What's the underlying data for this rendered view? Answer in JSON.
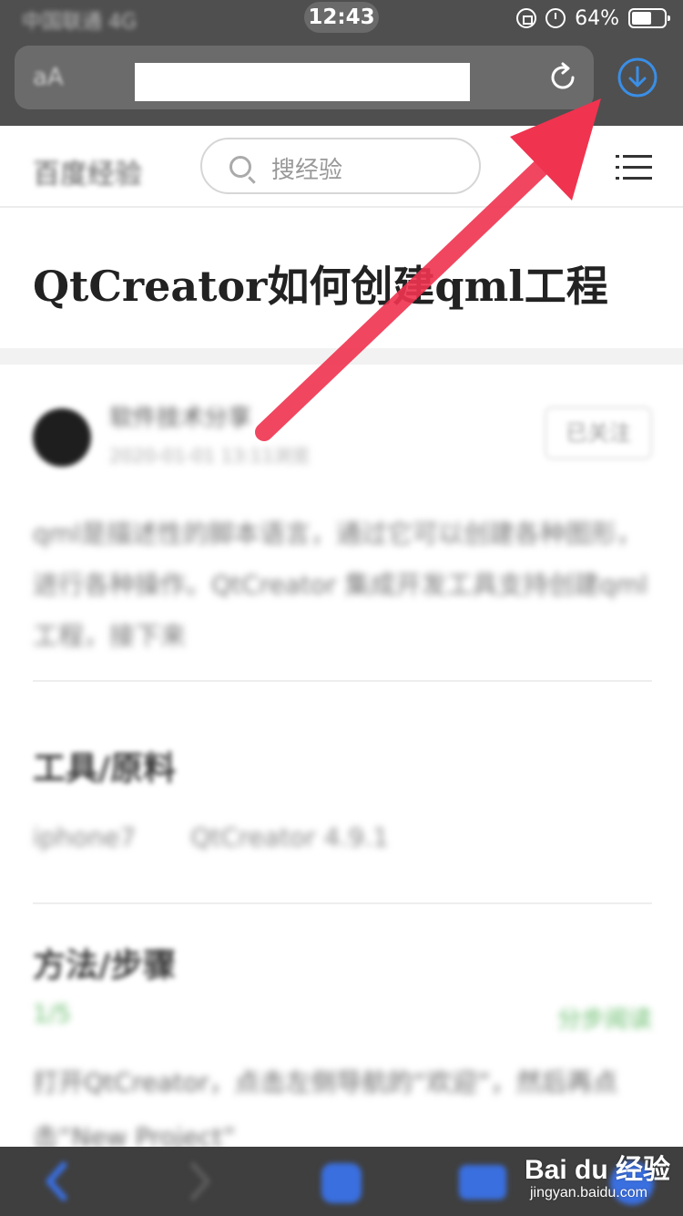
{
  "status_bar": {
    "carrier": "中国联通 4G",
    "time": "12:43",
    "battery": "64%",
    "battery_level": 0.64
  },
  "browser": {
    "aa_label": "aA",
    "reload_icon": "reload-icon",
    "download_icon": "download-icon",
    "accent": "#3a8ee6"
  },
  "site_header": {
    "logo": "百度经验",
    "search_placeholder": "搜经验",
    "menu_icon": "menu-icon"
  },
  "article": {
    "title": "QtCreator如何创建qml工程",
    "author": "软件技术分享",
    "date": "2020-01-01 13:11浏览",
    "follow_label": "已关注",
    "intro": "qml是描述性的脚本语言，通过它可以创建各种图形，进行各种操作。QtCreator 集成开发工具支持创建qml工程，接下来",
    "tools_heading": "工具/原料",
    "tools": [
      "iphone7",
      "QtCreator 4.9.1"
    ],
    "steps_heading": "方法/步骤",
    "step_index": "1/5",
    "step_toggle": "分步阅读",
    "step_text": "打开QtCreator，点击左侧导航的“欢迎”，然后再点击“New Project”"
  },
  "watermark": {
    "brand": "Bai du 经验",
    "url": "jingyan.baidu.com"
  },
  "annotation": {
    "arrow_color": "#f0334f"
  }
}
